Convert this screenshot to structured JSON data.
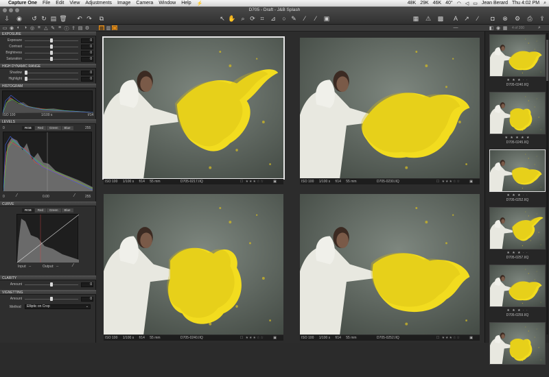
{
  "menubar": {
    "app": "Capture One",
    "items": [
      "File",
      "Edit",
      "View",
      "Adjustments",
      "Image",
      "Camera",
      "Window",
      "Help"
    ],
    "status": [
      "48K",
      "29K",
      "46K",
      "40°"
    ],
    "user": "Jean Berard",
    "clock": "Thu 4:02 PM"
  },
  "window": {
    "title": "D705 - Draft - J&B Splash"
  },
  "browser": {
    "counter": "4 of 200"
  },
  "left_panel": {
    "exposure": {
      "title": "EXPOSURE",
      "rows": [
        {
          "label": "Exposure",
          "value": "0",
          "level": 0.5
        },
        {
          "label": "Contrast",
          "value": "0",
          "level": 0.5
        },
        {
          "label": "Brightness",
          "value": "0",
          "level": 0.5
        },
        {
          "label": "Saturation",
          "value": "0",
          "level": 0.5
        }
      ]
    },
    "hdr": {
      "title": "HIGH DYNAMIC RANGE",
      "rows": [
        {
          "label": "Shadow",
          "value": "0",
          "level": 0.0
        },
        {
          "label": "Highlight",
          "value": "0",
          "level": 0.0
        }
      ]
    },
    "histogram": {
      "title": "HISTOGRAM",
      "iso": "ISO 100",
      "shutter": "1/100 s",
      "aperture": "f/14"
    },
    "levels": {
      "title": "LEVELS",
      "tabs": [
        "RGB",
        "Red",
        "Green",
        "Blue"
      ],
      "black": "0",
      "white": "255",
      "out_black": "0",
      "mid": "0.00",
      "out_white": "255"
    },
    "curve": {
      "title": "CURVE",
      "tabs": [
        "RGB",
        "Red",
        "Green",
        "Blue"
      ],
      "input_label": "Input:",
      "input_value": "--",
      "output_label": "Output:",
      "output_value": "--"
    },
    "clarity": {
      "title": "CLARITY",
      "rows": [
        {
          "label": "Amount",
          "value": "0",
          "level": 0.5
        }
      ]
    },
    "vignetting": {
      "title": "VIGNETTING",
      "rows": [
        {
          "label": "Amount",
          "value": "0",
          "level": 0.5
        }
      ],
      "method_label": "Method",
      "method_value": "Elliptic on Crop"
    }
  },
  "viewer": {
    "cells": [
      {
        "iso": "ISO 100",
        "shutter": "1/100 s",
        "aperture": "f/14",
        "focal": "55 mm",
        "file": "D705-0217.IIQ",
        "selected": true
      },
      {
        "iso": "ISO 100",
        "shutter": "1/100 s",
        "aperture": "f/14",
        "focal": "55 mm",
        "file": "D705-0230.IIQ",
        "selected": false
      },
      {
        "iso": "ISO 100",
        "shutter": "1/100 s",
        "aperture": "f/14",
        "focal": "55 mm",
        "file": "D705-0240.IIQ",
        "selected": false
      },
      {
        "iso": "ISO 100",
        "shutter": "1/100 s",
        "aperture": "f/14",
        "focal": "55 mm",
        "file": "D705-0252.IIQ",
        "selected": false
      }
    ]
  },
  "filmstrip": [
    {
      "file": "D705-0240.IIQ",
      "stars": "★ ★ ★ · ·"
    },
    {
      "file": "D705-0245.IIQ",
      "stars": "★ ★ ★ ★ ★"
    },
    {
      "file": "D705-0252.IIQ",
      "stars": "★ ★ ★ · ·"
    },
    {
      "file": "D705-0257.IIQ",
      "stars": "★ ★ ★ · ·"
    },
    {
      "file": "D705-0259.IIQ",
      "stars": "★ ★ ★ · ·"
    },
    {
      "file": "",
      "stars": ""
    }
  ],
  "colors": {
    "accent": "#e08a18",
    "paint": "#f2dc1f",
    "wall": "#6a736c"
  }
}
